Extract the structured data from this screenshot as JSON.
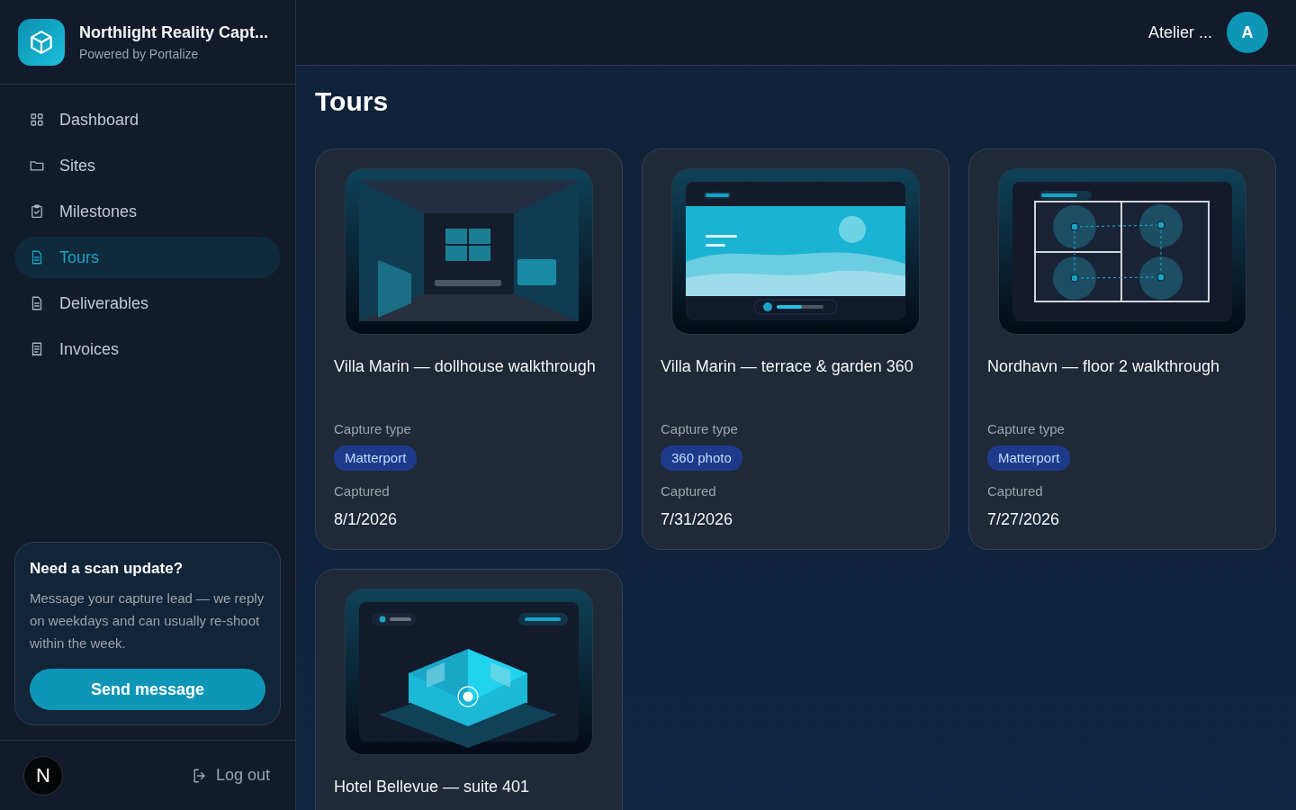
{
  "brand": {
    "name": "Northlight Reality Capt...",
    "subtitle": "Powered by Portalize"
  },
  "nav": [
    {
      "kind": "grid",
      "label": "Dashboard",
      "selected": false
    },
    {
      "kind": "folder",
      "label": "Sites",
      "selected": false
    },
    {
      "kind": "clipboard",
      "label": "Milestones",
      "selected": false
    },
    {
      "kind": "document",
      "label": "Tours",
      "selected": true
    },
    {
      "kind": "document",
      "label": "Deliverables",
      "selected": false
    },
    {
      "kind": "receipt",
      "label": "Invoices",
      "selected": false
    }
  ],
  "help_card": {
    "title": "Need a scan update?",
    "text": "Message your capture lead — we reply on weekdays and can usually re-shoot within the week.",
    "button": "Send message"
  },
  "footer": {
    "avatar_letter": "N",
    "logout": "Log out"
  },
  "header": {
    "user_name": "Atelier ...",
    "avatar_letter": "A"
  },
  "page_title": "Tours",
  "tours": [
    {
      "kind": "dollhouse",
      "title": "Villa Marin — dollhouse walkthrough",
      "capture_type_label": "Capture type",
      "capture_type": "Matterport",
      "captured_label": "Captured",
      "captured": "8/1/2026"
    },
    {
      "kind": "panorama",
      "title": "Villa Marin — terrace & garden 360",
      "capture_type_label": "Capture type",
      "capture_type": "360 photo",
      "captured_label": "Captured",
      "captured": "7/31/2026"
    },
    {
      "kind": "floorplan",
      "title": "Nordhavn — floor 2 walkthrough",
      "capture_type_label": "Capture type",
      "capture_type": "Matterport",
      "captured_label": "Captured",
      "captured": "7/27/2026"
    },
    {
      "kind": "isometric",
      "title": "Hotel Bellevue — suite 401"
    }
  ]
}
